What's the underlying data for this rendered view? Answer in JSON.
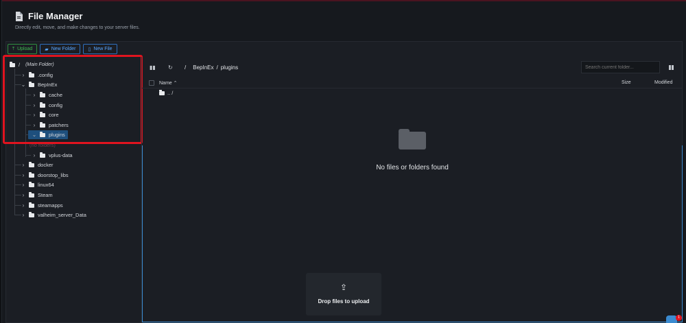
{
  "header": {
    "title": "File Manager",
    "subtitle": "Directly edit, move, and make changes to your server files."
  },
  "toolbar": {
    "upload_label": "Upload",
    "new_folder_label": "New Folder",
    "new_file_label": "New File"
  },
  "tree": {
    "root_label": "/",
    "root_hint": "(Main Folder)",
    "items": {
      "config": ".config",
      "bepinex": "BepInEx",
      "cache": "cache",
      "config2": "config",
      "core": "core",
      "patchers": "patchers",
      "plugins": "plugins",
      "no_folders": "(no folders)",
      "vplus": "vplus-data",
      "docker": "docker",
      "doorstop": "doorstop_libs",
      "linux64": "linux64",
      "steam": "Steam",
      "steamapps": "steamapps",
      "valheim": "valheim_server_Data"
    }
  },
  "breadcrumb": {
    "root": "/",
    "parts": [
      "BepInEx",
      "/",
      "plugins"
    ]
  },
  "search": {
    "placeholder": "Search current folder..."
  },
  "columns": {
    "name": "Name",
    "size": "Size",
    "modified": "Modified"
  },
  "parent_row": ".. /",
  "empty_message": "No files or folders found",
  "dropzone_label": "Drop files to upload",
  "chat_badge": "1",
  "colors": {
    "accent": "#3b8bd0",
    "selected": "#1e4f7d",
    "highlight": "#e0141f",
    "upload": "#3fb950"
  }
}
